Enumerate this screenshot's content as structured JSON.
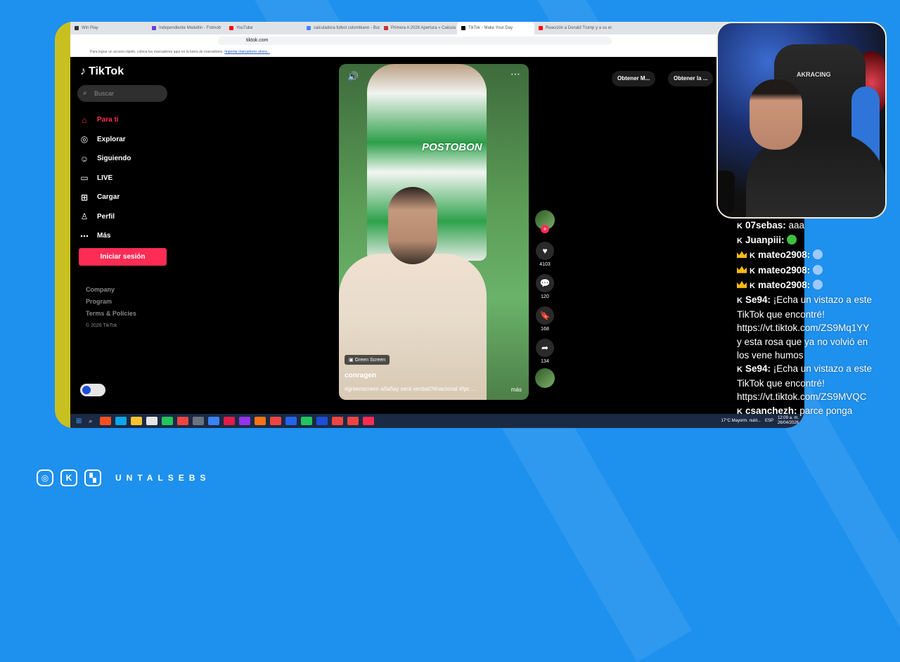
{
  "browser": {
    "tabs": [
      {
        "label": "Win Play",
        "color": "#333"
      },
      {
        "label": "Independiente Medellín - Fotmob",
        "color": "#6b3fd4"
      },
      {
        "label": "YouTube",
        "color": "#ff0000"
      },
      {
        "label": "calculadora futbol colombiano - Bus",
        "color": "#4285f4"
      },
      {
        "label": "Primera A 2026 Apertura » Calcula",
        "color": "#c33"
      },
      {
        "label": "TikTok - Make Your Day",
        "color": "#000"
      },
      {
        "label": "Reacción a Donald Trump y a su esp",
        "color": "#ff0000"
      }
    ],
    "url": "tiktok.com",
    "bookmarks_text": "Para lograr un acceso rápido, coloca tus marcadores aquí en la barra de marcadores.",
    "bookmarks_link": "Importar marcadores ahora..."
  },
  "tiktok": {
    "logo": "TikTok",
    "search_placeholder": "Buscar",
    "menu": [
      {
        "label": "Para ti",
        "icon": "home-icon"
      },
      {
        "label": "Explorar",
        "icon": "compass-icon"
      },
      {
        "label": "Siguiendo",
        "icon": "following-icon"
      },
      {
        "label": "LIVE",
        "icon": "live-icon"
      },
      {
        "label": "Cargar",
        "icon": "upload-icon"
      },
      {
        "label": "Perfil",
        "icon": "profile-icon"
      },
      {
        "label": "Más",
        "icon": "more-icon"
      }
    ],
    "login": "Iniciar sesión",
    "footer": [
      "Company",
      "Program",
      "Terms & Policies"
    ],
    "copyright": "© 2026 TikTok",
    "top_buttons": [
      "Obtener M...",
      "Obtener la ..."
    ],
    "video": {
      "shirt_text": "POSTOBON",
      "green_screen": "Green Screen",
      "username": "conragen",
      "caption": "#greenscreen añañay será verdad?#nacional #fpc ...",
      "more": "más"
    },
    "actions": {
      "likes": "4103",
      "comments": "120",
      "saves": "168",
      "shares": "134"
    }
  },
  "taskbar": {
    "weather": "17°C  Mayorm. nubl...",
    "lang": "ESP",
    "time": "12:09 a. m.",
    "date": "26/04/2026"
  },
  "webcam": {
    "chair_brand": "AKRACING"
  },
  "chat": [
    {
      "badges": [
        "kick"
      ],
      "user": "07sebas:",
      "text": " aaa"
    },
    {
      "badges": [
        "kick"
      ],
      "user": "Juanpiii:",
      "text": "",
      "emote": "#3fbf3f"
    },
    {
      "badges": [
        "crown",
        "kick"
      ],
      "user": "mateo2908:",
      "text": "",
      "emote": "#9ec9ff"
    },
    {
      "badges": [
        "crown",
        "kick"
      ],
      "user": "mateo2908:",
      "text": "",
      "emote": "#9ec9ff"
    },
    {
      "badges": [
        "crown",
        "kick"
      ],
      "user": "mateo2908:",
      "text": "",
      "emote": "#9ec9ff"
    },
    {
      "badges": [
        "kick"
      ],
      "user": "Se94:",
      "text": " ¡Echa un vistazo a este"
    },
    {
      "badges": [],
      "user": "",
      "text": "TikTok que encontré!"
    },
    {
      "badges": [],
      "user": "",
      "text": "https://vt.tiktok.com/ZS9Mq1YY"
    },
    {
      "badges": [],
      "user": "",
      "text": "y esta rosa que ya no volvió en"
    },
    {
      "badges": [],
      "user": "",
      "text": "los vene humos"
    },
    {
      "badges": [
        "kick"
      ],
      "user": "Se94:",
      "text": " ¡Echa un vistazo a este"
    },
    {
      "badges": [],
      "user": "",
      "text": "TikTok que encontré!"
    },
    {
      "badges": [],
      "user": "",
      "text": "https://vt.tiktok.com/ZS9MVQC"
    },
    {
      "badges": [
        "kick"
      ],
      "user": "csanchezh:",
      "text": " parce ponga"
    }
  ],
  "social": {
    "brand": "UNTALSEBS",
    "icons": [
      "instagram-icon",
      "kick-icon",
      "twitch-icon"
    ]
  },
  "colors": {
    "background": "#1e90ee",
    "tiktok_red": "#fe2c55",
    "frame": "#c8c020"
  }
}
